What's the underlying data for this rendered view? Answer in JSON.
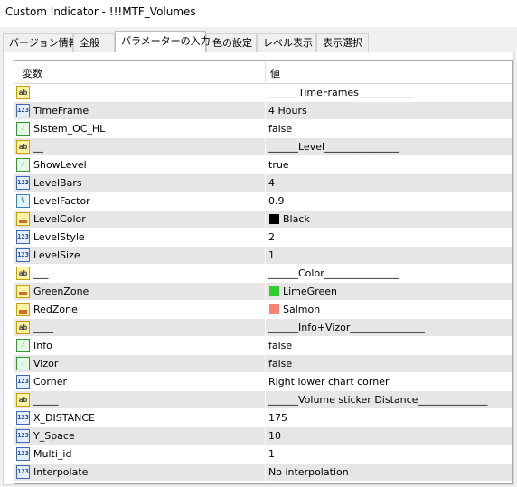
{
  "window": {
    "title": "Custom Indicator - !!!MTF_Volumes"
  },
  "tabs": [
    {
      "label": "バージョン情報",
      "active": false
    },
    {
      "label": "全般",
      "active": false
    },
    {
      "label": "パラメーターの入力",
      "active": true
    },
    {
      "label": "色の設定",
      "active": false
    },
    {
      "label": "レベル表示",
      "active": false
    },
    {
      "label": "表示選択",
      "active": false
    }
  ],
  "table": {
    "headers": {
      "variable": "変数",
      "value": "値"
    },
    "rows": [
      {
        "icon": "ab",
        "name": "_",
        "value": "______TimeFrames___________"
      },
      {
        "icon": "num",
        "name": "TimeFrame",
        "value": "4 Hours"
      },
      {
        "icon": "bool",
        "name": "Sistem_OC_HL",
        "value": "false"
      },
      {
        "icon": "ab",
        "name": "__",
        "value": "______Level_______________"
      },
      {
        "icon": "bool",
        "name": "ShowLevel",
        "value": "true"
      },
      {
        "icon": "num",
        "name": "LevelBars",
        "value": "4"
      },
      {
        "icon": "dbl",
        "name": "LevelFactor",
        "value": "0.9"
      },
      {
        "icon": "col",
        "name": "LevelColor",
        "value": "Black",
        "swatch": "#000000"
      },
      {
        "icon": "num",
        "name": "LevelStyle",
        "value": "2"
      },
      {
        "icon": "num",
        "name": "LevelSize",
        "value": "1"
      },
      {
        "icon": "ab",
        "name": "___",
        "value": "______Color_______________"
      },
      {
        "icon": "col",
        "name": "GreenZone",
        "value": "LimeGreen",
        "swatch": "#32cd32"
      },
      {
        "icon": "col",
        "name": "RedZone",
        "value": "Salmon",
        "swatch": "#fa8072"
      },
      {
        "icon": "ab",
        "name": "____",
        "value": "______Info+Vizor_______________"
      },
      {
        "icon": "bool",
        "name": "Info",
        "value": "false"
      },
      {
        "icon": "bool",
        "name": "Vizor",
        "value": "false"
      },
      {
        "icon": "num",
        "name": "Corner",
        "value": "Right lower chart corner"
      },
      {
        "icon": "ab",
        "name": "_____",
        "value": "______Volume sticker Distance______________"
      },
      {
        "icon": "num",
        "name": "X_DISTANCE",
        "value": "175"
      },
      {
        "icon": "num",
        "name": "Y_Space",
        "value": "10"
      },
      {
        "icon": "num",
        "name": "Multi_id",
        "value": "1"
      },
      {
        "icon": "num",
        "name": "Interpolate",
        "value": "No interpolation"
      }
    ]
  }
}
